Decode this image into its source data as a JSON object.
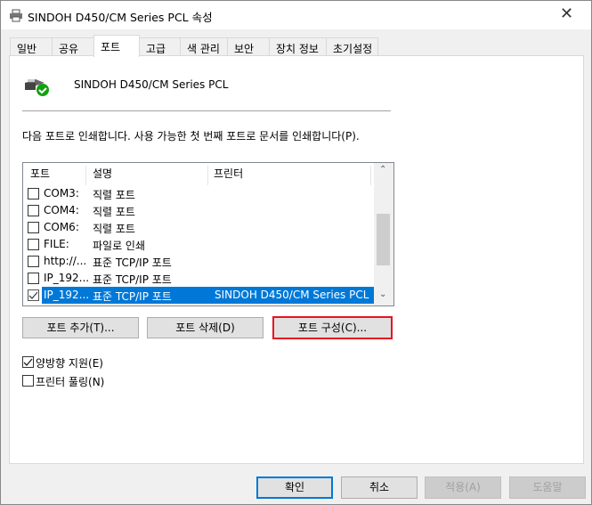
{
  "window": {
    "title": "SINDOH D450/CM Series PCL 속성",
    "close": "✕"
  },
  "tabs": [
    {
      "label": "일반"
    },
    {
      "label": "공유"
    },
    {
      "label": "포트",
      "selected": true
    },
    {
      "label": "고급"
    },
    {
      "label": "색 관리"
    },
    {
      "label": "보안"
    },
    {
      "label": "장치 정보"
    },
    {
      "label": "초기설정"
    }
  ],
  "printer_name": "SINDOH D450/CM Series PCL",
  "description": "다음 포트로 인쇄합니다. 사용 가능한 첫 번째 포트로 문서를 인쇄합니다(P).",
  "port_list": {
    "headers": {
      "port": "포트",
      "desc": "설명",
      "printer": "프린터"
    },
    "rows": [
      {
        "port": "COM3:",
        "desc": "직렬 포트",
        "printer": "",
        "checked": false
      },
      {
        "port": "COM4:",
        "desc": "직렬 포트",
        "printer": "",
        "checked": false
      },
      {
        "port": "COM6:",
        "desc": "직렬 포트",
        "printer": "",
        "checked": false
      },
      {
        "port": "FILE:",
        "desc": "파일로 인쇄",
        "printer": "",
        "checked": false
      },
      {
        "port": "http://...",
        "desc": "표준 TCP/IP 포트",
        "printer": "",
        "checked": false
      },
      {
        "port": "IP_192...",
        "desc": "표준 TCP/IP 포트",
        "printer": "",
        "checked": false
      },
      {
        "port": "IP_192...",
        "desc": "표준 TCP/IP 포트",
        "printer": "SINDOH D450/CM Series PCL",
        "checked": true,
        "selected": true
      }
    ]
  },
  "buttons": {
    "add": "포트 추가(T)...",
    "delete": "포트 삭제(D)",
    "configure": "포트 구성(C)..."
  },
  "options": {
    "bidirectional": {
      "label": "양방향 지원(E)",
      "checked": true
    },
    "pooling": {
      "label": "프린터 풀링(N)",
      "checked": false
    }
  },
  "footer": {
    "ok": "확인",
    "cancel": "취소",
    "apply": "적용(A)",
    "help": "도움말"
  }
}
